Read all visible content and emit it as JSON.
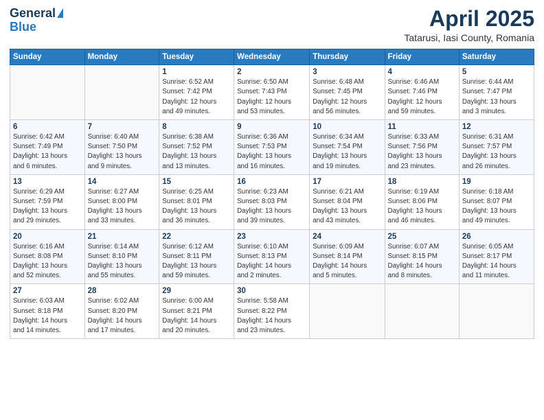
{
  "logo": {
    "general": "General",
    "blue": "Blue"
  },
  "header": {
    "title": "April 2025",
    "location": "Tatarusi, Iasi County, Romania"
  },
  "weekdays": [
    "Sunday",
    "Monday",
    "Tuesday",
    "Wednesday",
    "Thursday",
    "Friday",
    "Saturday"
  ],
  "weeks": [
    [
      {
        "day": "",
        "info": ""
      },
      {
        "day": "",
        "info": ""
      },
      {
        "day": "1",
        "info": "Sunrise: 6:52 AM\nSunset: 7:42 PM\nDaylight: 12 hours\nand 49 minutes."
      },
      {
        "day": "2",
        "info": "Sunrise: 6:50 AM\nSunset: 7:43 PM\nDaylight: 12 hours\nand 53 minutes."
      },
      {
        "day": "3",
        "info": "Sunrise: 6:48 AM\nSunset: 7:45 PM\nDaylight: 12 hours\nand 56 minutes."
      },
      {
        "day": "4",
        "info": "Sunrise: 6:46 AM\nSunset: 7:46 PM\nDaylight: 12 hours\nand 59 minutes."
      },
      {
        "day": "5",
        "info": "Sunrise: 6:44 AM\nSunset: 7:47 PM\nDaylight: 13 hours\nand 3 minutes."
      }
    ],
    [
      {
        "day": "6",
        "info": "Sunrise: 6:42 AM\nSunset: 7:49 PM\nDaylight: 13 hours\nand 6 minutes."
      },
      {
        "day": "7",
        "info": "Sunrise: 6:40 AM\nSunset: 7:50 PM\nDaylight: 13 hours\nand 9 minutes."
      },
      {
        "day": "8",
        "info": "Sunrise: 6:38 AM\nSunset: 7:52 PM\nDaylight: 13 hours\nand 13 minutes."
      },
      {
        "day": "9",
        "info": "Sunrise: 6:36 AM\nSunset: 7:53 PM\nDaylight: 13 hours\nand 16 minutes."
      },
      {
        "day": "10",
        "info": "Sunrise: 6:34 AM\nSunset: 7:54 PM\nDaylight: 13 hours\nand 19 minutes."
      },
      {
        "day": "11",
        "info": "Sunrise: 6:33 AM\nSunset: 7:56 PM\nDaylight: 13 hours\nand 23 minutes."
      },
      {
        "day": "12",
        "info": "Sunrise: 6:31 AM\nSunset: 7:57 PM\nDaylight: 13 hours\nand 26 minutes."
      }
    ],
    [
      {
        "day": "13",
        "info": "Sunrise: 6:29 AM\nSunset: 7:59 PM\nDaylight: 13 hours\nand 29 minutes."
      },
      {
        "day": "14",
        "info": "Sunrise: 6:27 AM\nSunset: 8:00 PM\nDaylight: 13 hours\nand 33 minutes."
      },
      {
        "day": "15",
        "info": "Sunrise: 6:25 AM\nSunset: 8:01 PM\nDaylight: 13 hours\nand 36 minutes."
      },
      {
        "day": "16",
        "info": "Sunrise: 6:23 AM\nSunset: 8:03 PM\nDaylight: 13 hours\nand 39 minutes."
      },
      {
        "day": "17",
        "info": "Sunrise: 6:21 AM\nSunset: 8:04 PM\nDaylight: 13 hours\nand 43 minutes."
      },
      {
        "day": "18",
        "info": "Sunrise: 6:19 AM\nSunset: 8:06 PM\nDaylight: 13 hours\nand 46 minutes."
      },
      {
        "day": "19",
        "info": "Sunrise: 6:18 AM\nSunset: 8:07 PM\nDaylight: 13 hours\nand 49 minutes."
      }
    ],
    [
      {
        "day": "20",
        "info": "Sunrise: 6:16 AM\nSunset: 8:08 PM\nDaylight: 13 hours\nand 52 minutes."
      },
      {
        "day": "21",
        "info": "Sunrise: 6:14 AM\nSunset: 8:10 PM\nDaylight: 13 hours\nand 55 minutes."
      },
      {
        "day": "22",
        "info": "Sunrise: 6:12 AM\nSunset: 8:11 PM\nDaylight: 13 hours\nand 59 minutes."
      },
      {
        "day": "23",
        "info": "Sunrise: 6:10 AM\nSunset: 8:13 PM\nDaylight: 14 hours\nand 2 minutes."
      },
      {
        "day": "24",
        "info": "Sunrise: 6:09 AM\nSunset: 8:14 PM\nDaylight: 14 hours\nand 5 minutes."
      },
      {
        "day": "25",
        "info": "Sunrise: 6:07 AM\nSunset: 8:15 PM\nDaylight: 14 hours\nand 8 minutes."
      },
      {
        "day": "26",
        "info": "Sunrise: 6:05 AM\nSunset: 8:17 PM\nDaylight: 14 hours\nand 11 minutes."
      }
    ],
    [
      {
        "day": "27",
        "info": "Sunrise: 6:03 AM\nSunset: 8:18 PM\nDaylight: 14 hours\nand 14 minutes."
      },
      {
        "day": "28",
        "info": "Sunrise: 6:02 AM\nSunset: 8:20 PM\nDaylight: 14 hours\nand 17 minutes."
      },
      {
        "day": "29",
        "info": "Sunrise: 6:00 AM\nSunset: 8:21 PM\nDaylight: 14 hours\nand 20 minutes."
      },
      {
        "day": "30",
        "info": "Sunrise: 5:58 AM\nSunset: 8:22 PM\nDaylight: 14 hours\nand 23 minutes."
      },
      {
        "day": "",
        "info": ""
      },
      {
        "day": "",
        "info": ""
      },
      {
        "day": "",
        "info": ""
      }
    ]
  ]
}
